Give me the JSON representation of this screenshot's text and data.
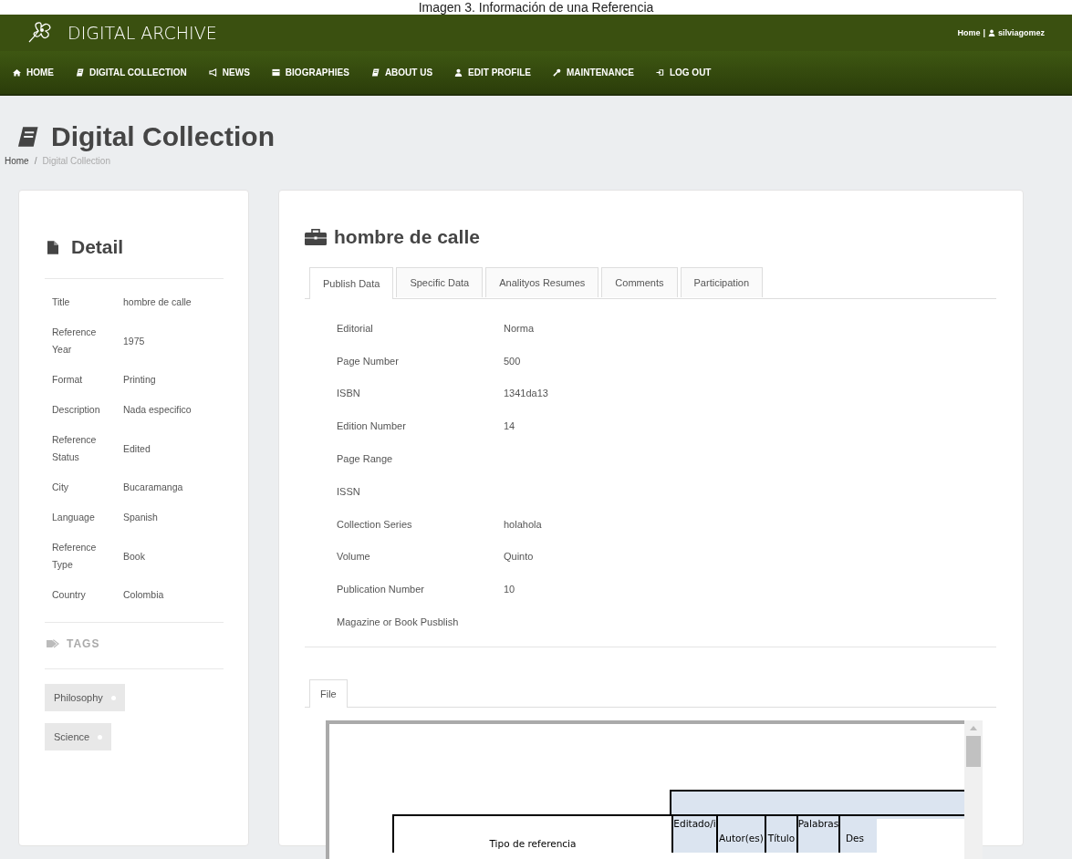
{
  "caption": "Imagen 3. Información de una Referencia",
  "header": {
    "brand": "DIGITAL ARCHIVE",
    "user_links": [
      {
        "label": "Home",
        "kind": "plain"
      },
      {
        "label": "silviagomez",
        "kind": "user"
      }
    ],
    "separator": "|"
  },
  "nav": [
    {
      "label": "HOME",
      "kind": "home"
    },
    {
      "label": "DIGITAL COLLECTION",
      "kind": "book"
    },
    {
      "label": "NEWS",
      "kind": "megaphone"
    },
    {
      "label": "BIOGRAPHIES",
      "kind": "list"
    },
    {
      "label": "ABOUT US",
      "kind": "book"
    },
    {
      "label": "EDIT PROFILE",
      "kind": "user"
    },
    {
      "label": "MAINTENANCE",
      "kind": "wrench"
    },
    {
      "label": "LOG OUT",
      "kind": "logout"
    }
  ],
  "page_title": "Digital Collection",
  "breadcrumb_separator": "/",
  "breadcrumbs": [
    {
      "label": "Home",
      "current": false
    },
    {
      "label": "Digital Collection",
      "current": true
    }
  ],
  "detail": {
    "title": "Detail",
    "fields": [
      {
        "label": "Title",
        "value": "hombre de calle"
      },
      {
        "label": "Reference Year",
        "value": "1975"
      },
      {
        "label": "Format",
        "value": "Printing"
      },
      {
        "label": "Description",
        "value": "Nada especifico"
      },
      {
        "label": "Reference Status",
        "value": "Edited"
      },
      {
        "label": "City",
        "value": "Bucaramanga"
      },
      {
        "label": "Language",
        "value": "Spanish"
      },
      {
        "label": "Reference Type",
        "value": "Book"
      },
      {
        "label": "Country",
        "value": "Colombia"
      }
    ],
    "tags_heading": "TAGS",
    "tags": [
      "Philosophy",
      "Science"
    ]
  },
  "record": {
    "title": "hombre de calle",
    "tabs": [
      {
        "label": "Publish Data",
        "selected": true
      },
      {
        "label": "Specific Data",
        "selected": false
      },
      {
        "label": "Analityos Resumes",
        "selected": false
      },
      {
        "label": "Comments",
        "selected": false
      },
      {
        "label": "Participation",
        "selected": false
      }
    ],
    "fields": [
      {
        "label": "Editorial",
        "value": "Norma"
      },
      {
        "label": "Page Number",
        "value": "500"
      },
      {
        "label": "ISBN",
        "value": "1341da13"
      },
      {
        "label": "Edition Number",
        "value": "14"
      },
      {
        "label": "Page Range"
      },
      {
        "label": "ISSN"
      },
      {
        "label": "Collection Series",
        "value": "holahola"
      },
      {
        "label": "Volume",
        "value": "Quinto"
      },
      {
        "label": "Publication Number",
        "value": "10"
      },
      {
        "label": "Magazine or Book Pusblish"
      }
    ],
    "file_tabs": [
      {
        "label": "File",
        "selected": true
      }
    ],
    "document": {
      "row_header": "Tipo de referencia",
      "columns": [
        "Editado/i",
        "Autor(es)",
        "Título",
        "Palabras",
        "Des"
      ]
    }
  }
}
